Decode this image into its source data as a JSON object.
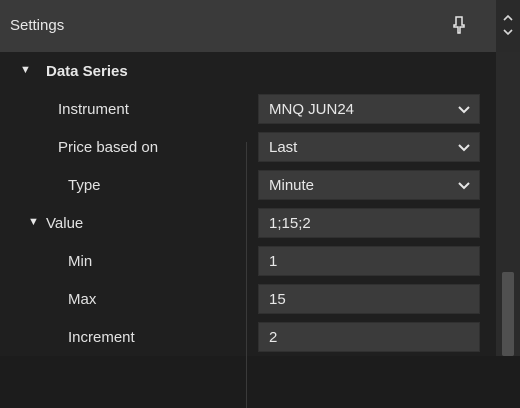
{
  "panel": {
    "title": "Settings",
    "pin_icon": "pin-icon",
    "spin_up_icon": "chevron-up-icon",
    "spin_down_icon": "chevron-down-icon"
  },
  "section": {
    "label": "Data Series",
    "expanded": true
  },
  "rows": {
    "instrument": {
      "name": "Instrument",
      "value": "MNQ JUN24",
      "dropdown": true
    },
    "price_based_on": {
      "name": "Price based on",
      "value": "Last",
      "dropdown": true
    },
    "type": {
      "name": "Type",
      "value": "Minute",
      "dropdown": true
    },
    "value": {
      "name": "Value",
      "value": "1;15;2",
      "expanded": true
    },
    "min": {
      "name": "Min",
      "value": "1"
    },
    "max": {
      "name": "Max",
      "value": "15"
    },
    "increment": {
      "name": "Increment",
      "value": "2"
    }
  },
  "colors": {
    "background": "#1f1f1f",
    "field": "#3b3b3b",
    "titlebar": "#3a3a3a",
    "text": "#e6e6e6"
  }
}
